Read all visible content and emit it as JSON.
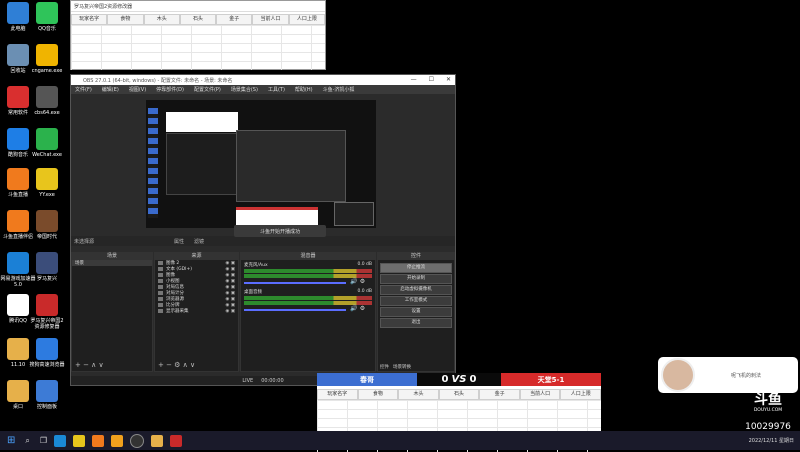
{
  "desktop_icons": [
    {
      "label": "此电脑",
      "icon": "computer-icon",
      "color": "#2f7fd6"
    },
    {
      "label": "QQ音乐",
      "icon": "qq-music-icon",
      "color": "#2fc45a"
    },
    {
      "label": "回收站",
      "icon": "recycle-bin-icon",
      "color": "#6b8fb3"
    },
    {
      "label": "cngame.exe",
      "icon": "cngame-icon",
      "color": "#f0b400"
    },
    {
      "label": "常用软件",
      "icon": "folder-icon",
      "color": "#d92f2f"
    },
    {
      "label": "cbs64.exe",
      "icon": "cbs64-icon",
      "color": "#555555"
    },
    {
      "label": "酷狗音乐",
      "icon": "kugou-icon",
      "color": "#1e7ee6"
    },
    {
      "label": "WeChat.exe",
      "icon": "wechat-icon",
      "color": "#2bb24c"
    },
    {
      "label": "斗鱼直播",
      "icon": "douyu-icon",
      "color": "#f07a1d"
    },
    {
      "label": "YY.exe",
      "icon": "yy-icon",
      "color": "#e8c51c"
    },
    {
      "label": "斗鱼直播伴侣",
      "icon": "douyu-companion-icon",
      "color": "#f07a1d"
    },
    {
      "label": "帝国时代",
      "icon": "age-of-empires-icon",
      "color": "#7a4b2b"
    },
    {
      "label": "网易游戏加速器5.0",
      "icon": "netease-booster-icon",
      "color": "#1b80d6"
    },
    {
      "label": "罗马复兴",
      "icon": "rome-icon",
      "color": "#3b4d7a"
    },
    {
      "label": "腾讯QQ",
      "icon": "qq-icon",
      "color": "#ffffff"
    },
    {
      "label": "罗马复兴帝国2资源修复器",
      "icon": "repair-tool-icon",
      "color": "#c92a2a"
    },
    {
      "label": "11.10",
      "icon": "folder-icon",
      "color": "#e6b04a"
    },
    {
      "label": "搜狗高速浏览器",
      "icon": "sogou-browser-icon",
      "color": "#2d7be0"
    },
    {
      "label": "桌口",
      "icon": "folder-icon",
      "color": "#e6b04a"
    },
    {
      "label": "控制面板",
      "icon": "control-panel-icon",
      "color": "#3d7bd6"
    }
  ],
  "stats_window_top": {
    "title": "罗马复兴帝国2资源修改器",
    "columns": [
      "玩家名字",
      "食物",
      "木头",
      "石头",
      "金子",
      "当前人口",
      "人口上限"
    ]
  },
  "obs": {
    "title": "OBS 27.0.1 (64-bit, windows) - 配置文件: 未命名 - 场景: 未命名",
    "menu": [
      "文件(F)",
      "编辑(E)",
      "视图(V)",
      "停靠部件(D)",
      "配置文件(P)",
      "场景集合(S)",
      "工具(T)",
      "帮助(H)",
      "斗鱼-济凯小狐"
    ],
    "source_selected": "未选择源",
    "properties_btn": "属性",
    "filters_btn": "滤镜",
    "toast": "斗鱼开始开播成功",
    "docks": {
      "scenes_title": "场景",
      "scenes": [
        "场景"
      ],
      "sources_title": "来源",
      "sources": [
        "图像 2",
        "文本 (GDI+)",
        "图像",
        "小视图",
        "对局信息",
        "对局计分",
        "浏览器源",
        "比分牌",
        "显示器采集"
      ],
      "mixer_title": "混音器",
      "mixer": [
        {
          "name": "麦克风/Aux",
          "level": "0.0 dB"
        },
        {
          "name": "桌面音频",
          "level": "0.0 dB"
        }
      ],
      "controls_title": "控件",
      "controls": [
        "停止推流",
        "开始录制",
        "启动虚拟摄像机",
        "工作室模式",
        "设置",
        "退出"
      ],
      "controls_tabs": [
        "控件",
        "场景转换"
      ]
    },
    "status": {
      "live": "LIVE",
      "time": "00:00:00"
    }
  },
  "scoreboard": {
    "left_team": "春哥",
    "left_score": "0",
    "vs": "VS",
    "right_score": "0",
    "right_team": "天堂5-1",
    "columns": [
      "玩家名字",
      "食物",
      "木头",
      "石头",
      "金子",
      "当前人口",
      "人口上限"
    ]
  },
  "streamer_overlay": {
    "caption": "呢飞机的刺法"
  },
  "watermark": {
    "brand": "斗鱼",
    "url": "DOUYU.COM",
    "room_id": "10029976"
  },
  "taskbar": {
    "clock_time": "",
    "clock_date": "2022/12/11 星期日"
  }
}
